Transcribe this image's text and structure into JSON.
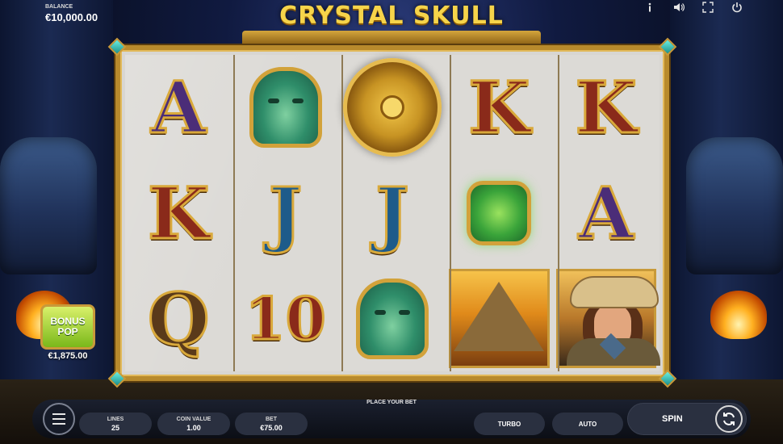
{
  "game": {
    "title": "CRYSTAL SKULL"
  },
  "balance": {
    "label": "BALANCE",
    "value": "€10,000.00"
  },
  "top_icons": [
    "info-icon",
    "sound-icon",
    "fullscreen-icon",
    "power-icon"
  ],
  "reels": {
    "columns": [
      [
        "A",
        "K",
        "Q"
      ],
      [
        "aztec-mask",
        "J",
        "10"
      ],
      [
        "sun-stone",
        "J",
        "aztec-mask"
      ],
      [
        "K",
        "snake",
        "pyramid"
      ],
      [
        "K",
        "A",
        "explorer"
      ]
    ]
  },
  "bonus_pop": {
    "line1": "BONUS",
    "line2": "POP",
    "amount": "€1,875.00"
  },
  "controls": {
    "status": "PLACE YOUR BET",
    "lines_label": "LINES",
    "lines_value": "25",
    "coin_label": "COIN VALUE",
    "coin_value": "1.00",
    "bet_label": "BET",
    "bet_value": "€75.00",
    "turbo_label": "TURBO",
    "auto_label": "AUTO",
    "spin_label": "SPIN"
  },
  "colors": {
    "title_gold": "#f6d44a",
    "frame_gold": "#b88a2c",
    "bonus_green": "#7ab81a"
  }
}
